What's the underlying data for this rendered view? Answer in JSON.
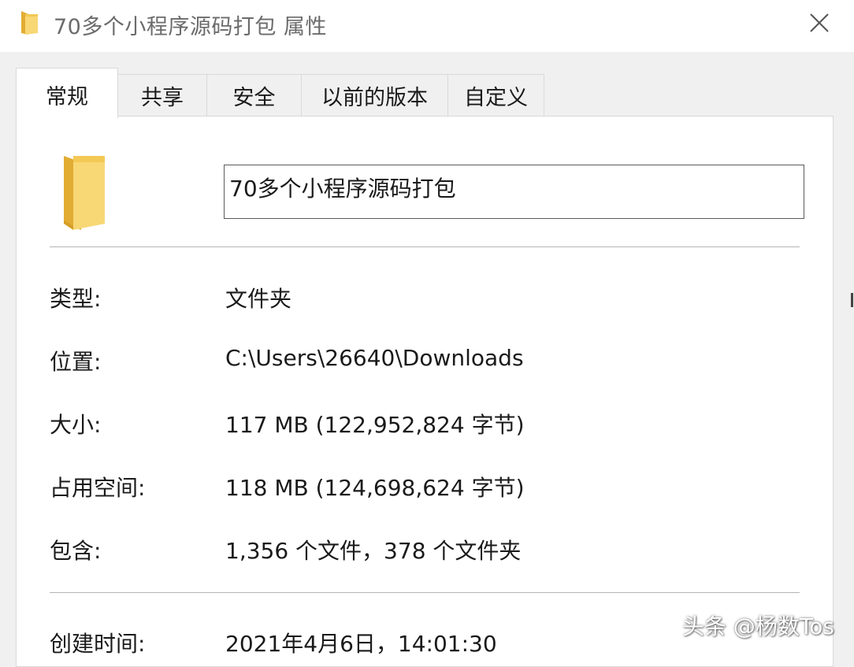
{
  "window": {
    "title": "70多个小程序源码打包 属性",
    "close_icon": "close-icon",
    "title_icon": "folder-icon"
  },
  "tabs": [
    {
      "label": "常规",
      "active": true
    },
    {
      "label": "共享",
      "active": false
    },
    {
      "label": "安全",
      "active": false
    },
    {
      "label": "以前的版本",
      "active": false
    },
    {
      "label": "自定义",
      "active": false
    }
  ],
  "general": {
    "folder_name": "70多个小程序源码打包",
    "properties": [
      {
        "label": "类型:",
        "value": "文件夹"
      },
      {
        "label": "位置:",
        "value": "C:\\Users\\26640\\Downloads"
      },
      {
        "label": "大小:",
        "value": "117 MB (122,952,824 字节)"
      },
      {
        "label": "占用空间:",
        "value": "118 MB (124,698,624 字节)"
      },
      {
        "label": "包含:",
        "value": "1,356 个文件，378 个文件夹"
      }
    ],
    "created": {
      "label": "创建时间:",
      "value": "2021年4月6日，14:01:30"
    }
  },
  "watermark": "头条 @杨数Tos",
  "colors": {
    "folder_front": "#f8d775",
    "folder_back": "#e8b43c",
    "window_bg": "#f0f0f0",
    "panel_bg": "#ffffff"
  }
}
